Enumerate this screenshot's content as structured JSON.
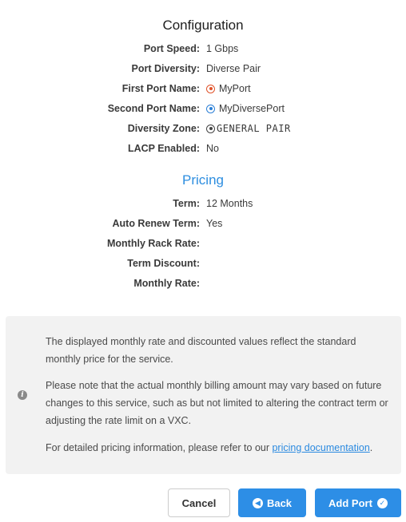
{
  "configuration": {
    "title": "Configuration",
    "rows": [
      {
        "label": "Port Speed:",
        "value": "1 Gbps"
      },
      {
        "label": "Port Diversity:",
        "value": "Diverse Pair"
      },
      {
        "label": "First Port Name:",
        "value": "MyPort",
        "icon": "red-dot-icon"
      },
      {
        "label": "Second Port Name:",
        "value": "MyDiversePort",
        "icon": "blue-dot-icon"
      },
      {
        "label": "Diversity Zone:",
        "value": "GENERAL PAIR",
        "icon": "grey-dot-icon"
      },
      {
        "label": "LACP Enabled:",
        "value": "No"
      }
    ]
  },
  "pricing": {
    "title": "Pricing",
    "rows": [
      {
        "label": "Term:",
        "value": "12 Months"
      },
      {
        "label": "Auto Renew Term:",
        "value": "Yes"
      },
      {
        "label": "Monthly Rack Rate:",
        "value": ""
      },
      {
        "label": "Term Discount:",
        "value": ""
      },
      {
        "label": "Monthly Rate:",
        "value": ""
      }
    ]
  },
  "info": {
    "p1": "The displayed monthly rate and discounted values reflect the standard monthly price for the service.",
    "p2": "Please note that the actual monthly billing amount may vary based on future changes to this service, such as but not limited to altering the contract term or adjusting the rate limit on a VXC.",
    "p3_prefix": "For detailed pricing information, please refer to our ",
    "p3_link": "pricing documentation",
    "p3_suffix": "."
  },
  "buttons": {
    "cancel": "Cancel",
    "back": "Back",
    "add": "Add Port"
  },
  "colors": {
    "accent": "#2d8ee6",
    "first_port_dot": "#e0532a",
    "second_port_dot": "#2b7fd6"
  }
}
